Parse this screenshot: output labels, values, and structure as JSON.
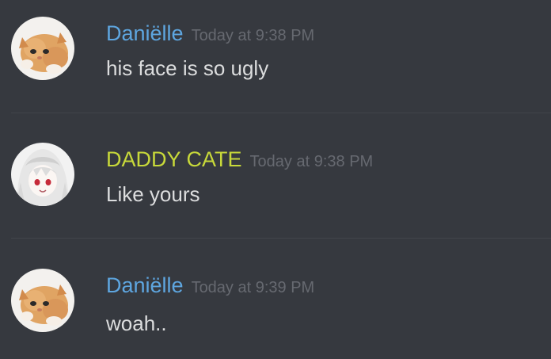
{
  "colors": {
    "background": "#36393f",
    "text": "#dcddde",
    "timestamp": "#666970",
    "divider": "#42454b",
    "user_danielle": "#5ea6e0",
    "user_daddy_cate": "#c8d93a"
  },
  "messages": [
    {
      "author": "Daniëlle",
      "timestamp": "Today at 9:38 PM",
      "text": "his face is so ugly",
      "avatar": "kitten-avatar"
    },
    {
      "author": "DADDY CATE",
      "timestamp": "Today at 9:38 PM",
      "text": "Like yours",
      "avatar": "anime-girl-avatar"
    },
    {
      "author": "Daniëlle",
      "timestamp": "Today at 9:39 PM",
      "text": "woah..",
      "avatar": "kitten-avatar"
    }
  ]
}
